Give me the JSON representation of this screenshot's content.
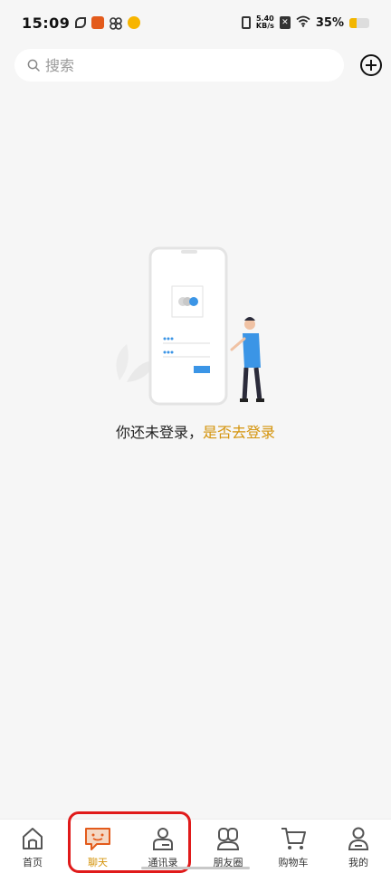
{
  "status_bar": {
    "time": "15:09",
    "net_speed_top": "5.40",
    "net_speed_unit": "KB/s",
    "battery_percent": "35%",
    "battery_level": 0.35
  },
  "search": {
    "placeholder": "搜索"
  },
  "empty_state": {
    "message": "你还未登录，",
    "action_link": "是否去登录"
  },
  "bottom_nav": {
    "items": [
      {
        "label": "首页",
        "icon": "home-icon"
      },
      {
        "label": "聊天",
        "icon": "chat-icon",
        "active": true
      },
      {
        "label": "通讯录",
        "icon": "contacts-icon"
      },
      {
        "label": "朋友圈",
        "icon": "moments-icon"
      },
      {
        "label": "购物车",
        "icon": "cart-icon"
      },
      {
        "label": "我的",
        "icon": "profile-icon"
      }
    ]
  },
  "colors": {
    "accent": "#d4930a",
    "active_icon": "#e35b1c",
    "highlight": "#e01a1a",
    "background": "#f6f6f6"
  }
}
